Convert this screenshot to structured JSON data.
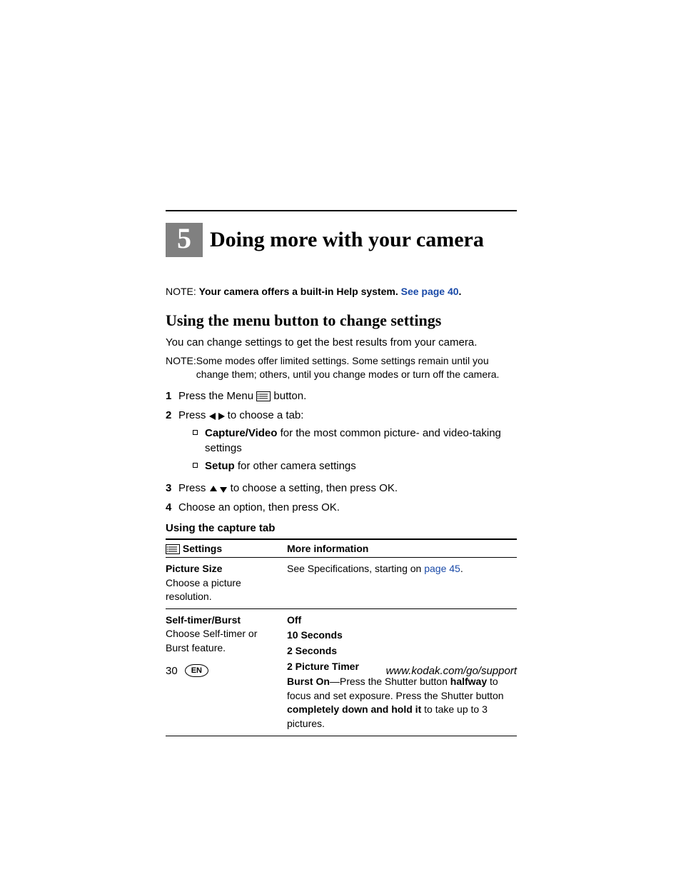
{
  "chapter": {
    "number": "5",
    "title": "Doing more with your camera"
  },
  "note1": {
    "label": "NOTE:",
    "bold": "Your camera offers a built-in Help system.",
    "link": "See page 40",
    "tail": "."
  },
  "section": {
    "title": "Using the menu button to change settings",
    "intro": "You can change settings to get the best results from your camera."
  },
  "note2": {
    "label": "NOTE:",
    "text": "Some modes offer limited settings. Some settings remain until you change them; others, until you change modes or turn off the camera."
  },
  "steps": {
    "s1": {
      "n": "1",
      "pre": "Press the Menu ",
      "post": " button."
    },
    "s2": {
      "n": "2",
      "pre": "Press ",
      "post": " to choose a tab:"
    },
    "b1": {
      "bold": "Capture/Video",
      "rest": " for the most common picture- and video-taking settings"
    },
    "b2": {
      "bold": "Setup",
      "rest": " for other camera settings"
    },
    "s3": {
      "n": "3",
      "pre": "Press ",
      "post": " to choose a setting, then press OK."
    },
    "s4": {
      "n": "4",
      "text": "Choose an option, then press OK."
    }
  },
  "captureTab": {
    "heading": "Using the capture tab",
    "headers": {
      "c1": "Settings",
      "c2": "More information"
    },
    "row1": {
      "title": "Picture Size",
      "desc": "Choose a picture resolution.",
      "info_pre": "See Specifications, starting on ",
      "info_link": "page 45",
      "info_post": "."
    },
    "row2": {
      "title": "Self-timer/Burst",
      "desc": "Choose Self-timer or Burst feature.",
      "opts": {
        "o1": "Off",
        "o2": "10 Seconds",
        "o3": "2 Seconds",
        "o4": "2 Picture Timer"
      },
      "burst": {
        "lead": "Burst On",
        "t1": "—Press the Shutter button ",
        "b1": "halfway",
        "t2": " to focus and set exposure. Press the Shutter button ",
        "b2": "completely down and hold it",
        "t3": " to take up to 3 pictures."
      }
    }
  },
  "footer": {
    "page": "30",
    "lang": "EN",
    "url": "www.kodak.com/go/support"
  }
}
